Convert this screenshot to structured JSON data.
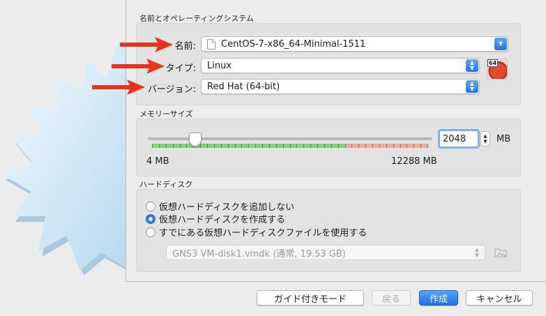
{
  "sections": {
    "name_os_title": "名前とオペレーティングシステム",
    "memory_title": "メモリーサイズ",
    "hard_disk_title": "ハードディスク"
  },
  "fields": {
    "name": {
      "label": "名前:",
      "value": "CentOS-7-x86_64-Minimal-1511"
    },
    "type": {
      "label": "タイプ:",
      "value": "Linux"
    },
    "version": {
      "label": "バージョン:",
      "value": "Red Hat (64-bit)"
    },
    "os_badge": "64"
  },
  "memory": {
    "value": "2048",
    "unit": "MB",
    "min_label": "4 MB",
    "max_label": "12288 MB",
    "min_mb": 4,
    "max_mb": 12288,
    "slider_value_mb": 2048
  },
  "hard_disk": {
    "options": [
      {
        "label": "仮想ハードディスクを追加しない",
        "selected": false
      },
      {
        "label": "仮想ハードディスクを作成する",
        "selected": true
      },
      {
        "label": "すでにある仮想ハードディスクファイルを使用する",
        "selected": false
      }
    ],
    "existing_file": "GNS3 VM-disk1.vmdk (通常, 19.53 GB)"
  },
  "buttons": {
    "guided_mode": "ガイド付きモード",
    "back": "戻る",
    "create": "作成",
    "cancel": "キャンセル"
  },
  "colors": {
    "accent": "#2274e6",
    "annotation_arrow": "#e8321c",
    "slider_green": "#7fd67a",
    "slider_red": "#f0a9a0"
  }
}
